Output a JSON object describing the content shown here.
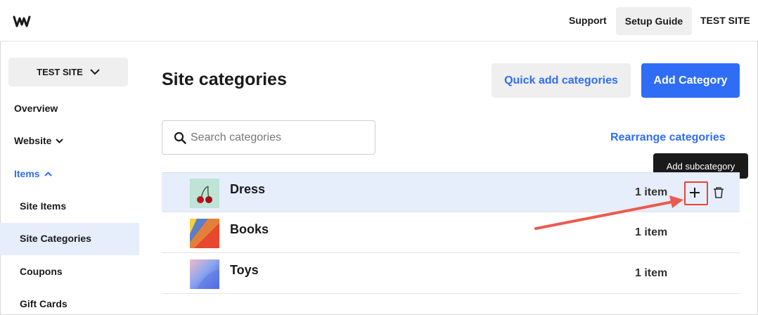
{
  "header": {
    "logo_icon": "weebly-logo",
    "support_label": "Support",
    "setup_guide_label": "Setup Guide",
    "site_label": "TEST SITE"
  },
  "sidebar": {
    "site_switcher_label": "TEST SITE",
    "items": [
      {
        "label": "Overview"
      },
      {
        "label": "Website"
      },
      {
        "label": "Items"
      }
    ],
    "sub_items": [
      {
        "label": "Site Items"
      },
      {
        "label": "Site Categories"
      },
      {
        "label": "Coupons"
      },
      {
        "label": "Gift Cards"
      }
    ]
  },
  "main": {
    "title": "Site categories",
    "quick_add_label": "Quick add categories",
    "add_category_label": "Add Category",
    "search_placeholder": "Search categories",
    "search_value": "",
    "rearrange_label": "Rearrange categories",
    "tooltip": "Add subcategory",
    "categories": [
      {
        "name": "Dress",
        "count": "1 item"
      },
      {
        "name": "Books",
        "count": "1 item"
      },
      {
        "name": "Toys",
        "count": "1 item"
      }
    ]
  },
  "colors": {
    "accent": "#2f6df6",
    "highlight_row": "#e6eefb",
    "annotation": "#ea4335"
  }
}
